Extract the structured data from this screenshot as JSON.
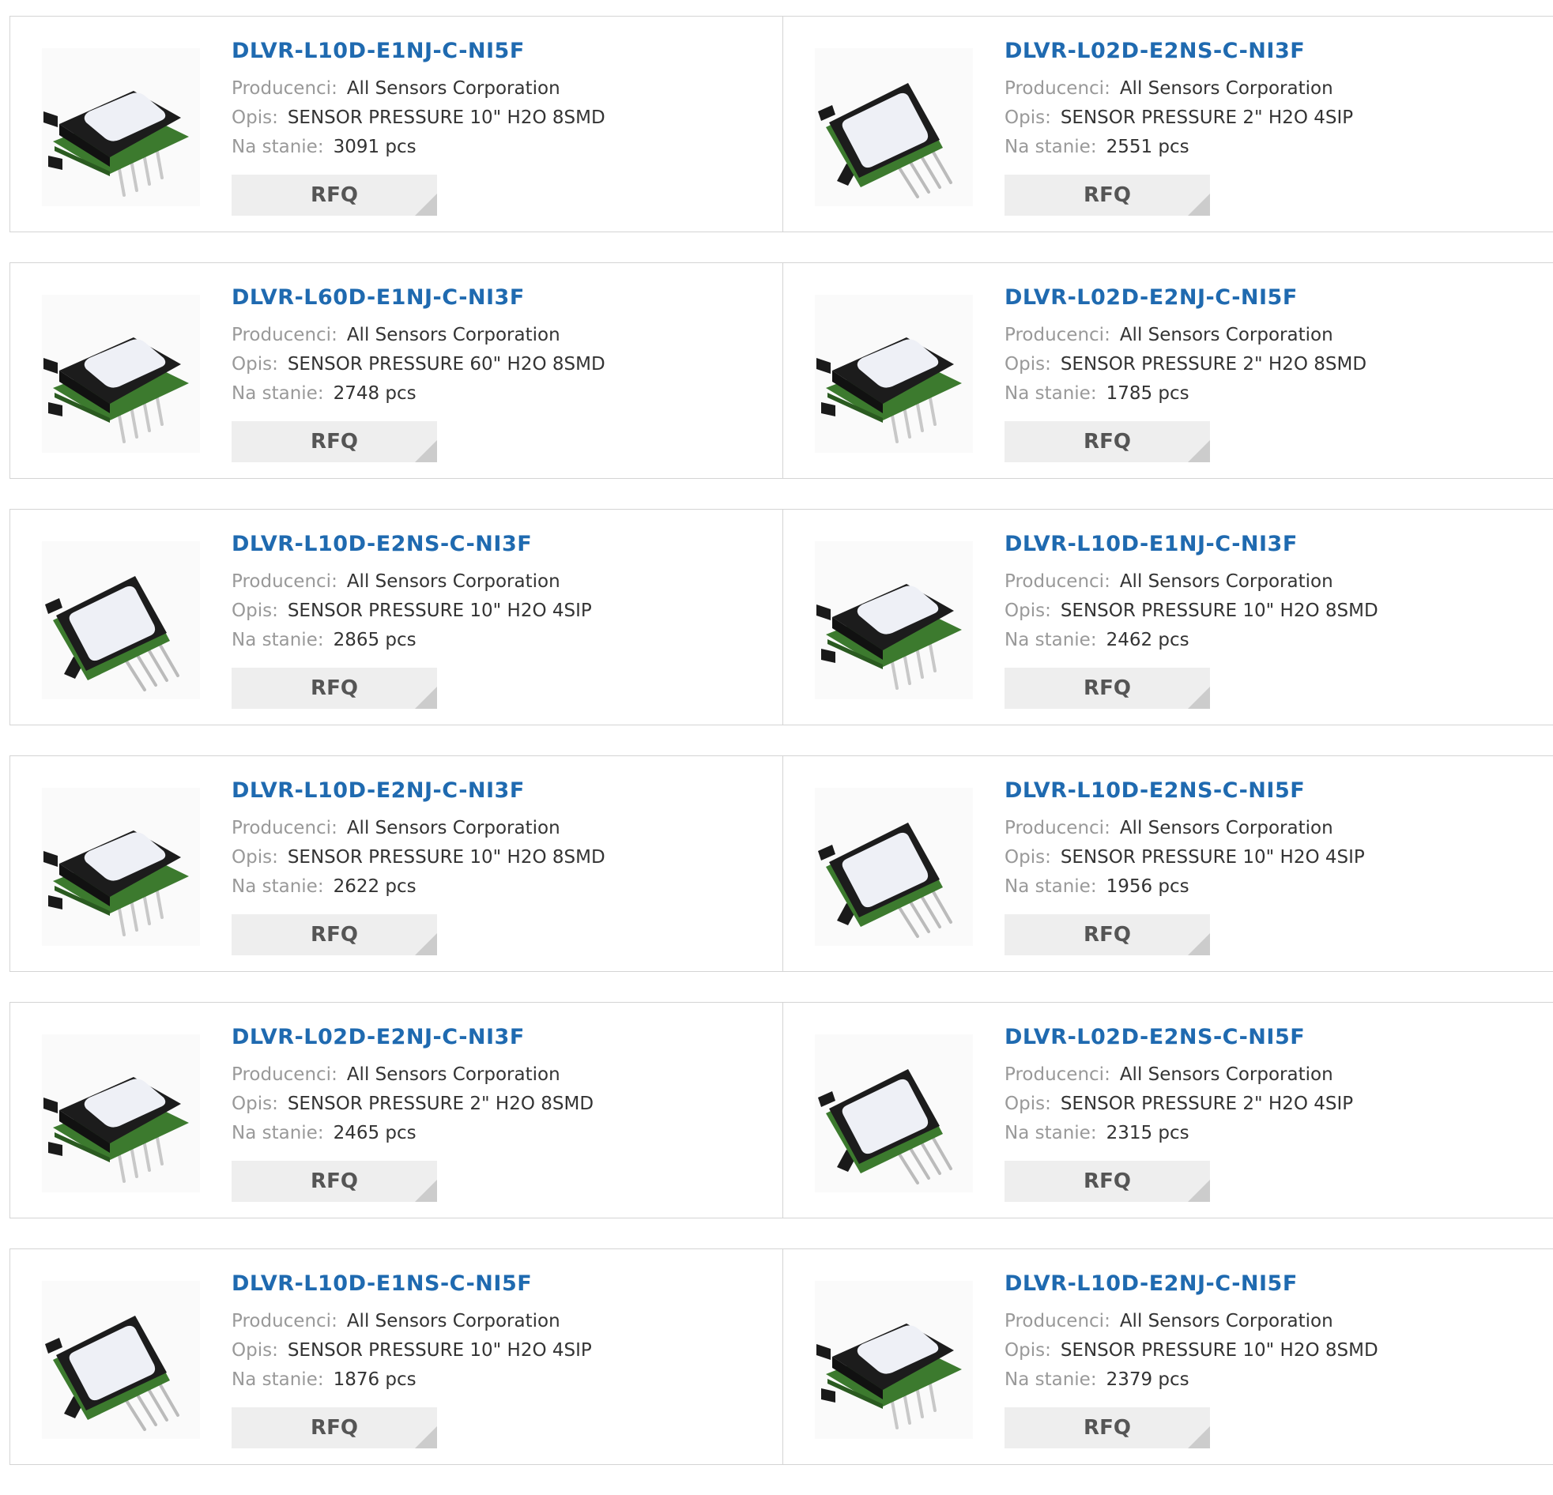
{
  "labels": {
    "manufacturer": "Producenci:",
    "description": "Opis:",
    "stock": "Na stanie:",
    "rfq": "RFQ"
  },
  "products": [
    {
      "part": "DLVR-L10D-E1NJ-C-NI5F",
      "manufacturer": "All Sensors Corporation",
      "description": "SENSOR PRESSURE 10\" H2O 8SMD",
      "stock": "3091 pcs",
      "package": "8smd"
    },
    {
      "part": "DLVR-L02D-E2NS-C-NI3F",
      "manufacturer": "All Sensors Corporation",
      "description": "SENSOR PRESSURE 2\" H2O 4SIP",
      "stock": "2551 pcs",
      "package": "4sip"
    },
    {
      "part": "DLVR-L60D-E1NJ-C-NI3F",
      "manufacturer": "All Sensors Corporation",
      "description": "SENSOR PRESSURE 60\" H2O 8SMD",
      "stock": "2748 pcs",
      "package": "8smd"
    },
    {
      "part": "DLVR-L02D-E2NJ-C-NI5F",
      "manufacturer": "All Sensors Corporation",
      "description": "SENSOR PRESSURE 2\" H2O 8SMD",
      "stock": "1785 pcs",
      "package": "8smd"
    },
    {
      "part": "DLVR-L10D-E2NS-C-NI3F",
      "manufacturer": "All Sensors Corporation",
      "description": "SENSOR PRESSURE 10\" H2O 4SIP",
      "stock": "2865 pcs",
      "package": "4sip"
    },
    {
      "part": "DLVR-L10D-E1NJ-C-NI3F",
      "manufacturer": "All Sensors Corporation",
      "description": "SENSOR PRESSURE 10\" H2O 8SMD",
      "stock": "2462 pcs",
      "package": "8smd"
    },
    {
      "part": "DLVR-L10D-E2NJ-C-NI3F",
      "manufacturer": "All Sensors Corporation",
      "description": "SENSOR PRESSURE 10\" H2O 8SMD",
      "stock": "2622 pcs",
      "package": "8smd"
    },
    {
      "part": "DLVR-L10D-E2NS-C-NI5F",
      "manufacturer": "All Sensors Corporation",
      "description": "SENSOR PRESSURE 10\" H2O 4SIP",
      "stock": "1956 pcs",
      "package": "4sip"
    },
    {
      "part": "DLVR-L02D-E2NJ-C-NI3F",
      "manufacturer": "All Sensors Corporation",
      "description": "SENSOR PRESSURE 2\" H2O 8SMD",
      "stock": "2465 pcs",
      "package": "8smd"
    },
    {
      "part": "DLVR-L02D-E2NS-C-NI5F",
      "manufacturer": "All Sensors Corporation",
      "description": "SENSOR PRESSURE 2\" H2O 4SIP",
      "stock": "2315 pcs",
      "package": "4sip"
    },
    {
      "part": "DLVR-L10D-E1NS-C-NI5F",
      "manufacturer": "All Sensors Corporation",
      "description": "SENSOR PRESSURE 10\" H2O 4SIP",
      "stock": "1876 pcs",
      "package": "4sip"
    },
    {
      "part": "DLVR-L10D-E2NJ-C-NI5F",
      "manufacturer": "All Sensors Corporation",
      "description": "SENSOR PRESSURE 10\" H2O 8SMD",
      "stock": "2379 pcs",
      "package": "8smd"
    }
  ]
}
